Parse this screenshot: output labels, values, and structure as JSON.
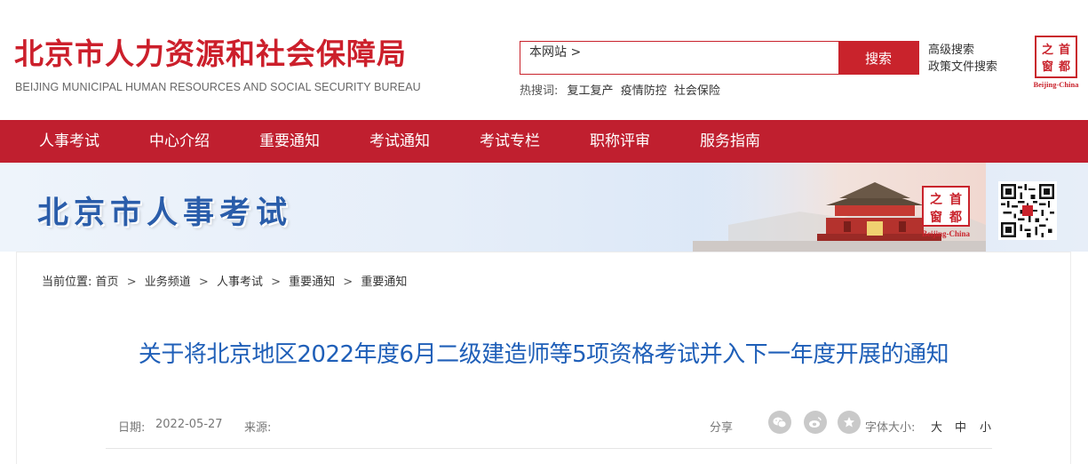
{
  "header": {
    "title": "北京市人力资源和社会保障局",
    "subtitle": "BEIJING MUNICIPAL HUMAN RESOURCES AND SOCIAL SECURITY BUREAU",
    "search": {
      "value": "本网站 >",
      "button": "搜索"
    },
    "hot": {
      "label": "热搜词:",
      "terms": [
        "复工复产",
        "疫情防控",
        "社会保险"
      ]
    },
    "links": [
      "高级搜索",
      "政策文件搜索"
    ],
    "seal": {
      "chars": [
        "之",
        "首",
        "窗",
        "都"
      ],
      "caption": "Beijing-China"
    }
  },
  "nav": [
    "人事考试",
    "中心介绍",
    "重要通知",
    "考试通知",
    "考试专栏",
    "职称评审",
    "服务指南"
  ],
  "banner": {
    "title": "北京市人事考试",
    "seal": {
      "chars": [
        "之",
        "首",
        "窗",
        "都"
      ],
      "caption": "Beijing-China"
    }
  },
  "breadcrumb": {
    "label": "当前位置:",
    "items": [
      "首页",
      "业务频道",
      "人事考试",
      "重要通知",
      "重要通知"
    ],
    "separator": ">"
  },
  "article": {
    "title": "关于将北京地区2022年度6月二级建造师等5项资格考试并入下一年度开展的通知",
    "date_label": "日期:",
    "date": "2022-05-27",
    "source_label": "来源:",
    "share_label": "分享",
    "share_icons": [
      "wechat-icon",
      "weibo-icon",
      "favorite-icon"
    ],
    "font_size_label": "字体大小:",
    "font_sizes": [
      "大",
      "中",
      "小"
    ]
  },
  "colors": {
    "brand_red": "#c01f2f",
    "title_blue": "#1f5fb8",
    "banner_blue": "#2a5daa"
  }
}
